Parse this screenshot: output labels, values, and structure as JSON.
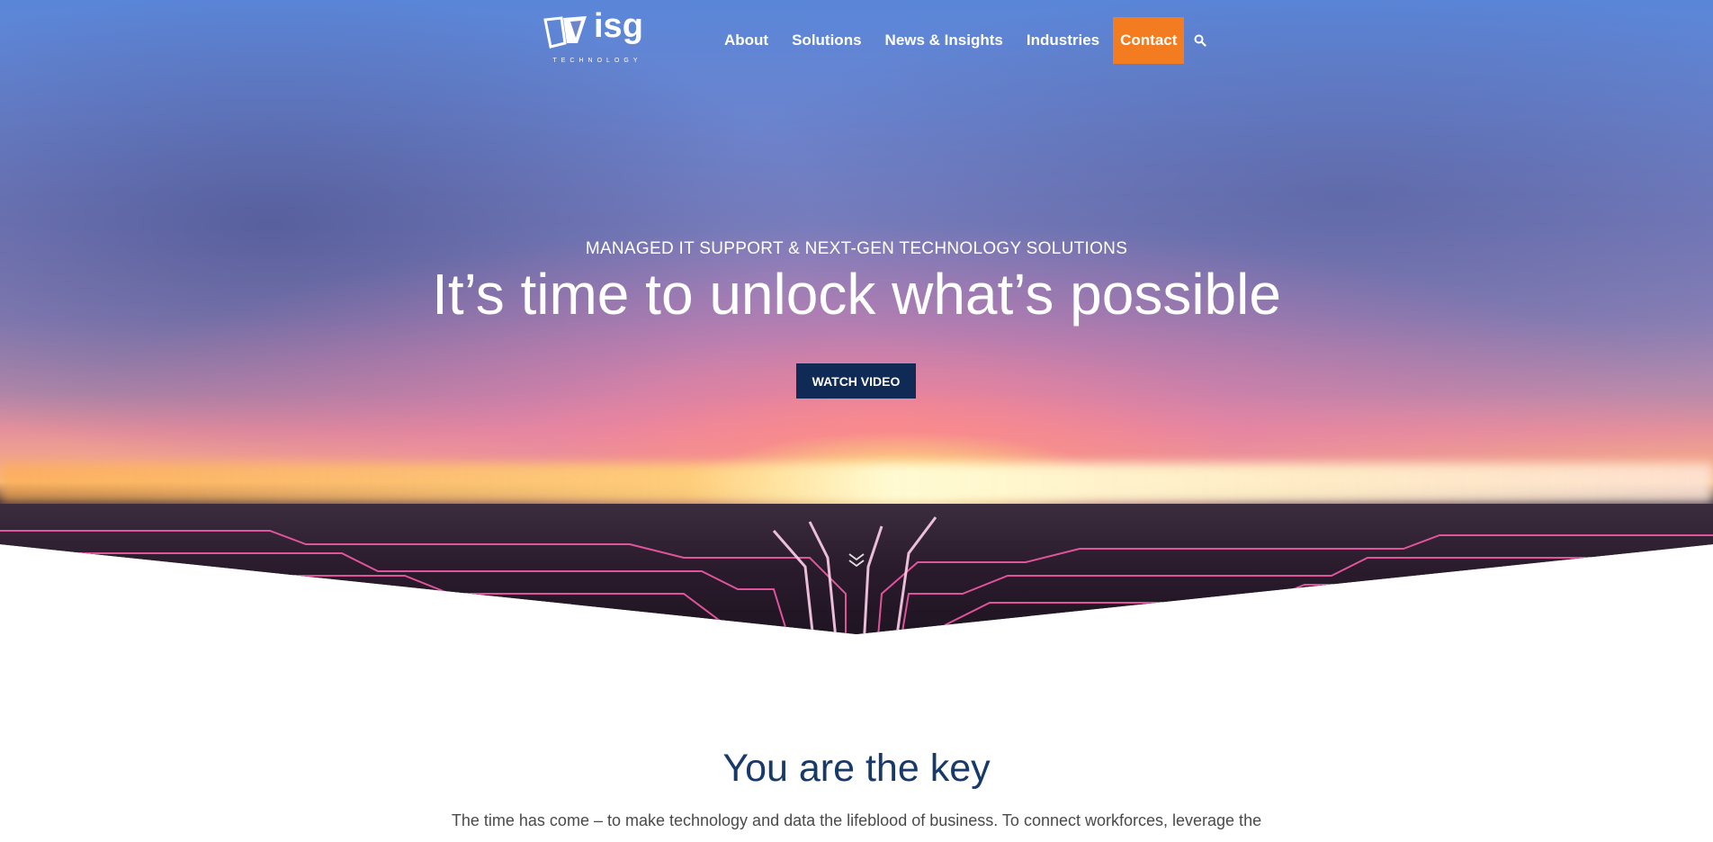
{
  "brand": {
    "logo_text": "isg",
    "logo_subtext": "TECHNOLOGY"
  },
  "nav": {
    "items": [
      {
        "label": "About"
      },
      {
        "label": "Solutions"
      },
      {
        "label": "News & Insights"
      },
      {
        "label": "Industries"
      },
      {
        "label": "Contact"
      }
    ],
    "search_icon": "search-icon"
  },
  "hero": {
    "kicker": "MANAGED IT SUPPORT & NEXT-GEN TECHNOLOGY SOLUTIONS",
    "title": "It’s time to unlock what’s possible",
    "button_label": "WATCH VIDEO",
    "scroll_icon": "chevron-down-double-icon"
  },
  "content": {
    "title": "You are the key",
    "body": "The time has come – to make technology and data the lifeblood of business. To connect workforces, leverage the"
  },
  "colors": {
    "accent": "#f47c20",
    "button_bg": "#0f2a55",
    "heading": "#173a6b",
    "body_text": "#4a4a4a"
  }
}
